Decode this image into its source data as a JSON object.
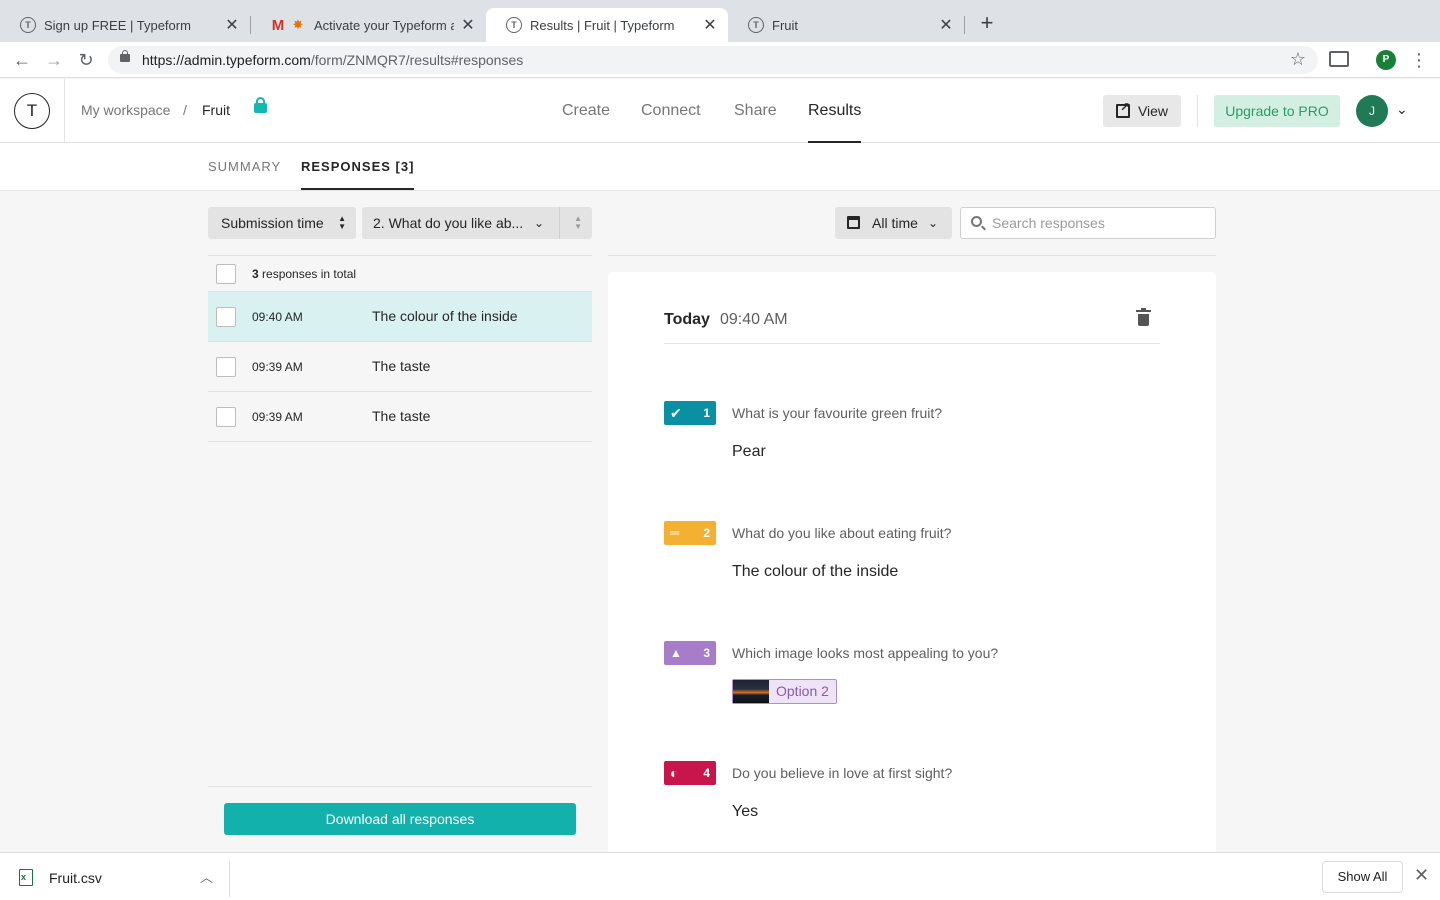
{
  "browser": {
    "tabs": [
      {
        "title": "Sign up FREE | Typeform",
        "favicon": "typeform-icon"
      },
      {
        "title": "Activate your Typeform acc",
        "favicon": "gmail-icon"
      },
      {
        "title": "Results | Fruit | Typeform",
        "favicon": "typeform-icon",
        "active": true
      },
      {
        "title": "Fruit",
        "favicon": "typeform-icon"
      }
    ],
    "url_host": "https://admin.typeform.com",
    "url_path": "/form/ZNMQR7/results#responses",
    "profile_initial": "P"
  },
  "header": {
    "logo_letter": "T",
    "workspace": "My workspace",
    "separator": "/",
    "form_name": "Fruit",
    "nav": [
      {
        "label": "Create"
      },
      {
        "label": "Connect"
      },
      {
        "label": "Share"
      },
      {
        "label": "Results",
        "active": true
      }
    ],
    "view_label": "View",
    "upgrade_label": "Upgrade to PRO",
    "avatar_initial": "J"
  },
  "subtabs": {
    "summary": "SUMMARY",
    "responses": "RESPONSES [3]"
  },
  "filters": {
    "sort_label": "Submission time",
    "question_label": "2. What do you like ab...",
    "time_label": "All time",
    "search_placeholder": "Search responses"
  },
  "list": {
    "total_count": "3",
    "total_suffix": "responses in total",
    "rows": [
      {
        "time": "09:40 AM",
        "answer": "The colour of the inside",
        "selected": true
      },
      {
        "time": "09:39 AM",
        "answer": "The taste"
      },
      {
        "time": "09:39 AM",
        "answer": "The taste"
      }
    ],
    "download_label": "Download all responses"
  },
  "detail": {
    "day": "Today",
    "time": "09:40 AM",
    "questions": [
      {
        "num": "1",
        "icon": "check-icon",
        "color": "#0a8fa3",
        "question": "What is your favourite green fruit?",
        "answer": "Pear"
      },
      {
        "num": "2",
        "icon": "long-text-icon",
        "color": "#f4b030",
        "question": "What do you like about eating fruit?",
        "answer": "The colour of the inside"
      },
      {
        "num": "3",
        "icon": "image-icon",
        "color": "#a77cc9",
        "question": "Which image looks most appealing to you?",
        "answer": "Option 2"
      },
      {
        "num": "4",
        "icon": "yes-no-icon",
        "color": "#c8164d",
        "question": "Do you believe in love at first sight?",
        "answer": "Yes"
      }
    ]
  },
  "downloads": {
    "file_name": "Fruit.csv",
    "show_all_label": "Show All"
  }
}
